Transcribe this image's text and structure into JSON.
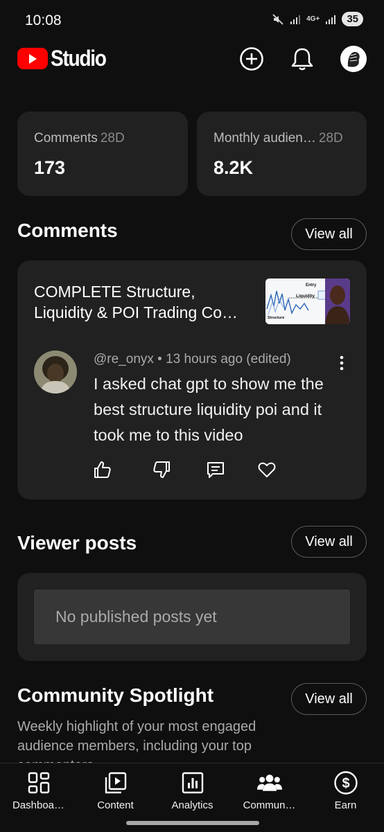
{
  "status_bar": {
    "time": "10:08",
    "network": "4G+",
    "battery": "35"
  },
  "header": {
    "logo_text": "Studio",
    "brand_color": "#ff0000"
  },
  "stats": [
    {
      "label": "Comments",
      "period": "28D",
      "value": "173"
    },
    {
      "label": "Monthly audien…",
      "period": "28D",
      "value": "8.2K"
    }
  ],
  "comments_section": {
    "title": "Comments",
    "view_all": "View all",
    "video_title": "COMPLETE Structure, Liquidity & POI Trading Co…",
    "thumbnail_labels": {
      "entry": "Entry",
      "liquidity": "Liquidity",
      "structure": "Structure"
    },
    "comment": {
      "author": "@re_onyx",
      "meta_rest": " • 13 hours ago (edited)",
      "text": "I asked chat gpt to show me the best structure liquidity poi and it took me to this video"
    },
    "actions": [
      "like-icon",
      "dislike-icon",
      "reply-icon",
      "heart-icon"
    ]
  },
  "viewer_posts": {
    "title": "Viewer posts",
    "view_all": "View all",
    "empty_text": "No published posts yet"
  },
  "spotlight": {
    "title": "Community Spotlight",
    "view_all": "View all",
    "description": "Weekly highlight of your most engaged audience members, including your top commenters"
  },
  "nav": [
    {
      "label": "Dashboa…",
      "icon": "dashboard-icon"
    },
    {
      "label": "Content",
      "icon": "content-icon"
    },
    {
      "label": "Analytics",
      "icon": "analytics-icon"
    },
    {
      "label": "Commun…",
      "icon": "community-icon"
    },
    {
      "label": "Earn",
      "icon": "earn-icon"
    }
  ]
}
